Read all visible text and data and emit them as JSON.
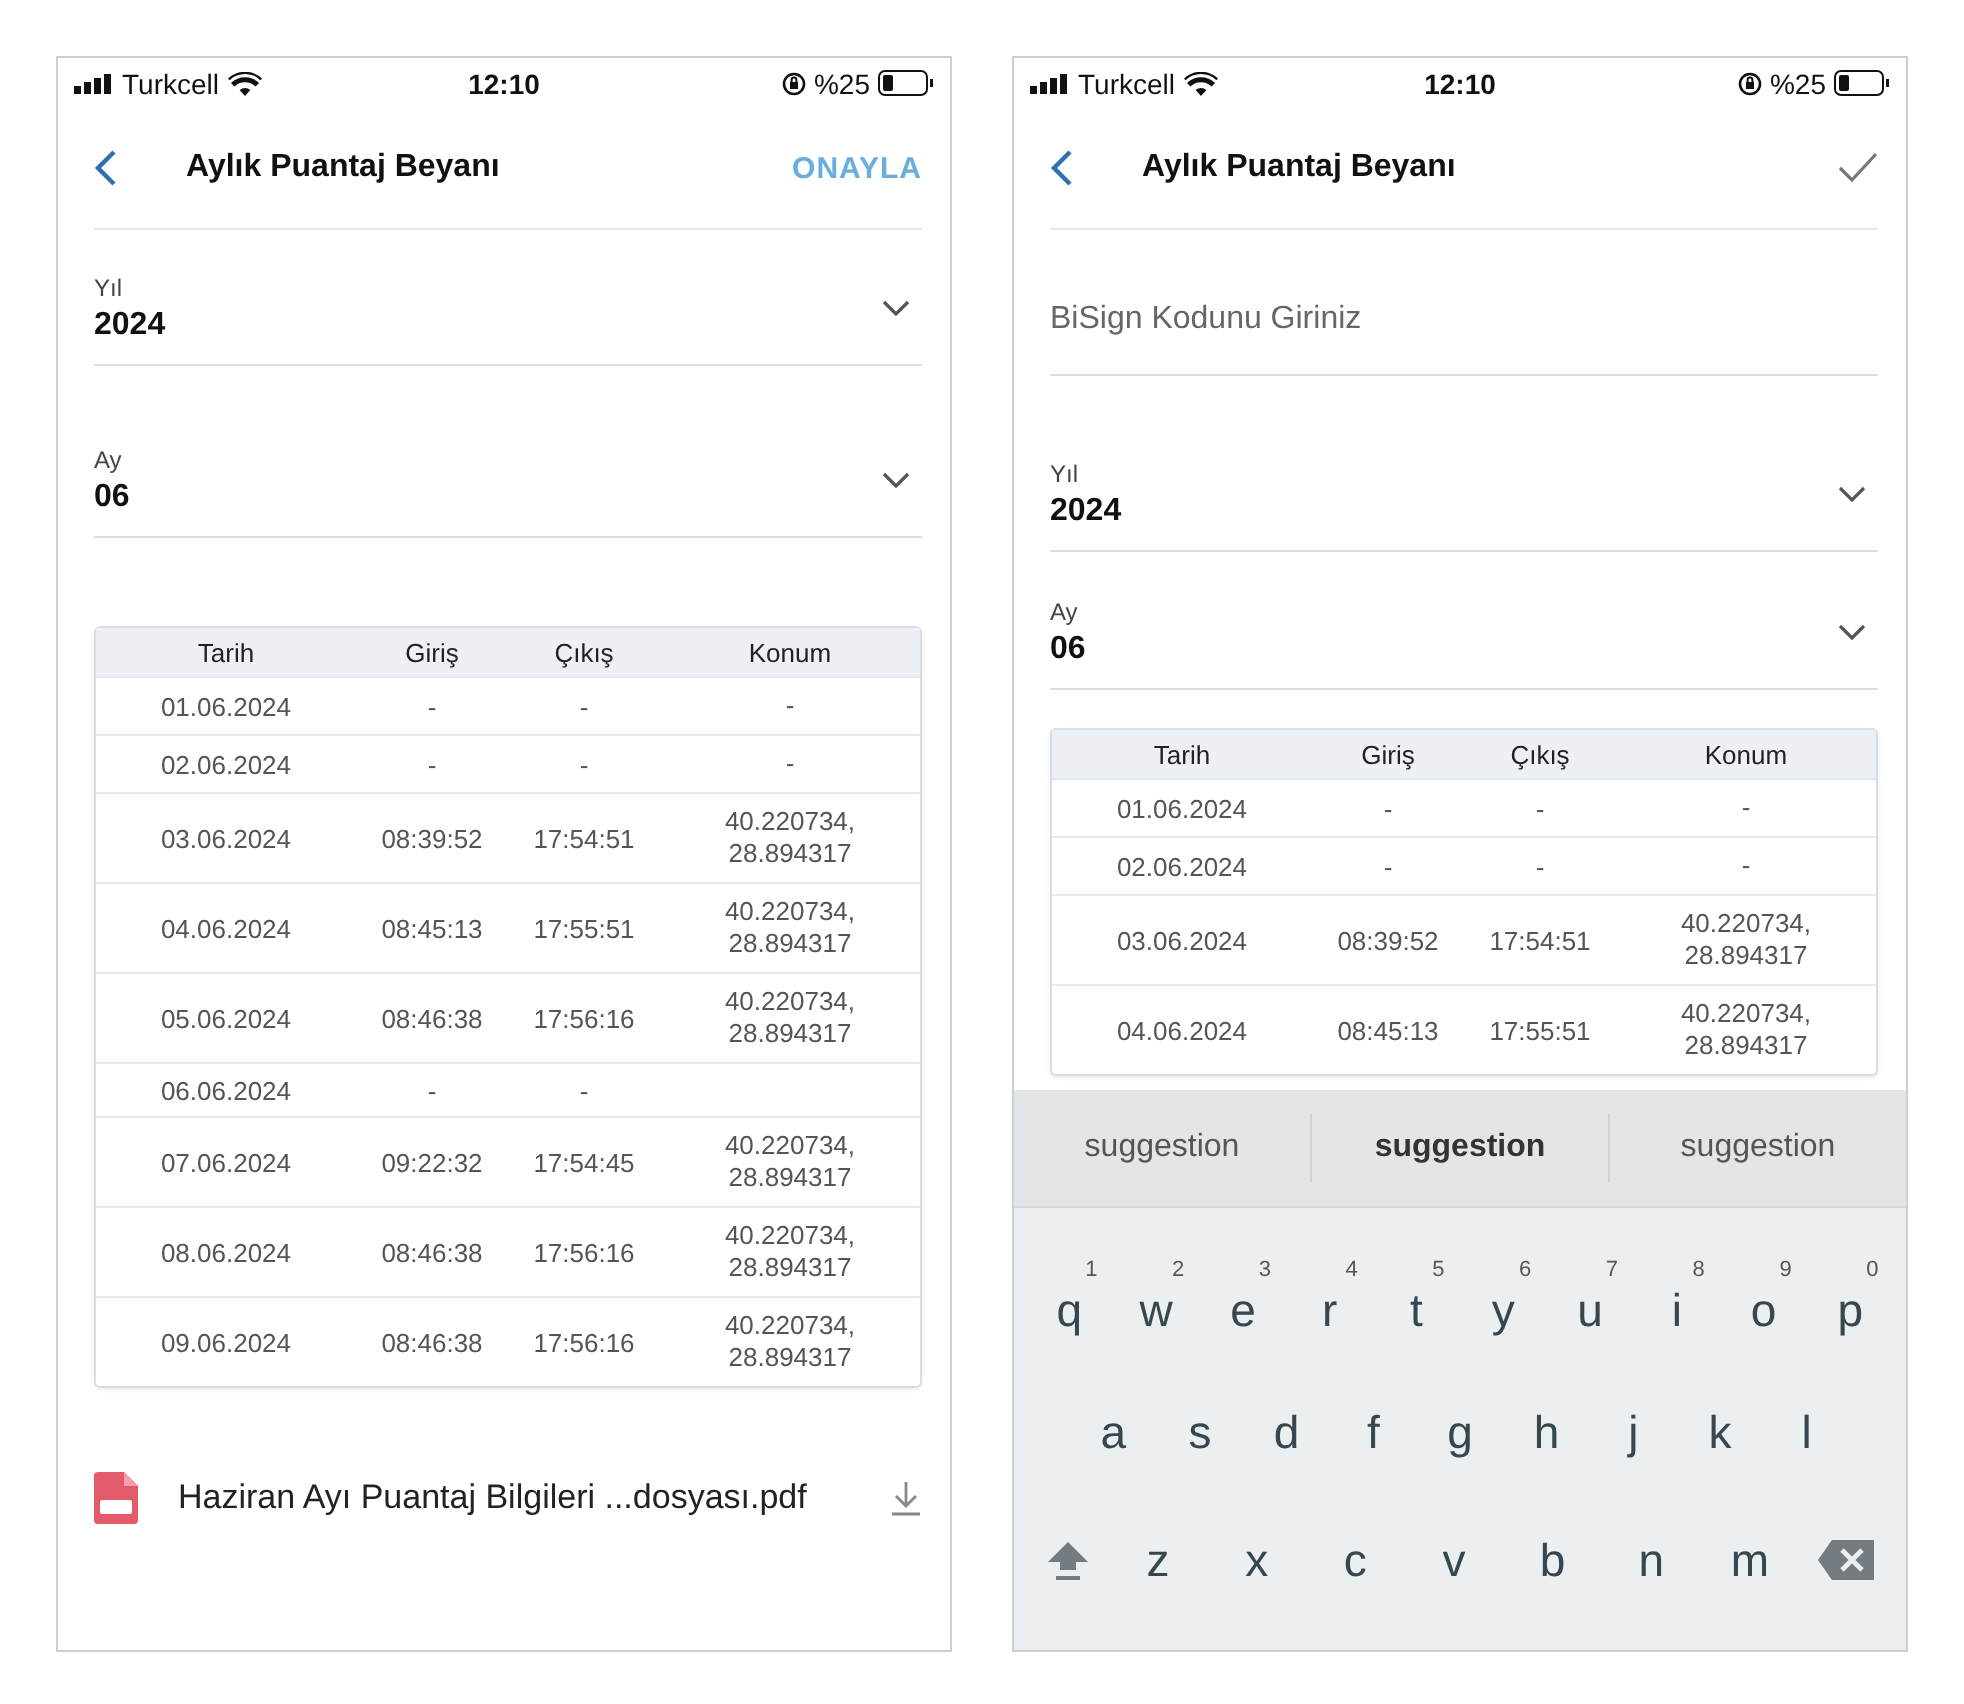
{
  "screens": [
    {
      "status_bar": {
        "carrier": "Turkcell",
        "time": "12:10",
        "battery": "%25"
      },
      "header": {
        "title": "Aylık Puantaj Beyanı",
        "action": {
          "kind": "text",
          "label": "ONAYLA"
        }
      },
      "selects": [
        {
          "label": "Yıl",
          "value": "2024"
        },
        {
          "label": "Ay",
          "value": "06"
        }
      ],
      "table": {
        "columns": [
          "Tarih",
          "Giriş",
          "Çıkış",
          "Konum"
        ],
        "rows": [
          {
            "date": "01.06.2024",
            "in": "-",
            "out": "-",
            "location": "-"
          },
          {
            "date": "02.06.2024",
            "in": "-",
            "out": "-",
            "location": "-"
          },
          {
            "date": "03.06.2024",
            "in": "08:39:52",
            "out": "17:54:51",
            "location": "40.220734, 28.894317"
          },
          {
            "date": "04.06.2024",
            "in": "08:45:13",
            "out": "17:55:51",
            "location": "40.220734, 28.894317"
          },
          {
            "date": "05.06.2024",
            "in": "08:46:38",
            "out": "17:56:16",
            "location": "40.220734, 28.894317"
          },
          {
            "date": "06.06.2024",
            "in": "-",
            "out": "-"
          },
          {
            "date": "07.06.2024",
            "in": "09:22:32",
            "out": "17:54:45",
            "location": "40.220734, 28.894317"
          },
          {
            "date": "08.06.2024",
            "in": "08:46:38",
            "out": "17:56:16",
            "location": "40.220734, 28.894317"
          },
          {
            "date": "09.06.2024",
            "in": "08:46:38",
            "out": "17:56:16",
            "location": "40.220734, 28.894317"
          }
        ]
      },
      "attachment": {
        "name": "Haziran Ayı Puantaj Bilgileri ...dosyası.pdf"
      }
    },
    {
      "status_bar": {
        "carrier": "Turkcell",
        "time": "12:10",
        "battery": "%25"
      },
      "header": {
        "title": "Aylık Puantaj Beyanı",
        "action": {
          "kind": "check"
        }
      },
      "code_field": {
        "placeholder": "BiSign Kodunu Giriniz"
      },
      "selects": [
        {
          "label": "Yıl",
          "value": "2024"
        },
        {
          "label": "Ay",
          "value": "06"
        }
      ],
      "table": {
        "columns": [
          "Tarih",
          "Giriş",
          "Çıkış",
          "Konum"
        ],
        "rows": [
          {
            "date": "01.06.2024",
            "in": "-",
            "out": "-",
            "location": "-"
          },
          {
            "date": "02.06.2024",
            "in": "-",
            "out": "-",
            "location": "-"
          },
          {
            "date": "03.06.2024",
            "in": "08:39:52",
            "out": "17:54:51",
            "location": "40.220734, 28.894317"
          },
          {
            "date": "04.06.2024",
            "in": "08:45:13",
            "out": "17:55:51",
            "location": "40.220734, 28.894317"
          }
        ]
      },
      "keyboard": {
        "suggestions": [
          {
            "text": "suggestion",
            "selected": false
          },
          {
            "text": "suggestion",
            "selected": true
          },
          {
            "text": "suggestion",
            "selected": false
          }
        ],
        "rows": [
          [
            {
              "key": "q",
              "hint": "1"
            },
            {
              "key": "w",
              "hint": "2"
            },
            {
              "key": "e",
              "hint": "3"
            },
            {
              "key": "r",
              "hint": "4"
            },
            {
              "key": "t",
              "hint": "5"
            },
            {
              "key": "y",
              "hint": "6"
            },
            {
              "key": "u",
              "hint": "7"
            },
            {
              "key": "i",
              "hint": "8"
            },
            {
              "key": "o",
              "hint": "9"
            },
            {
              "key": "p",
              "hint": "0"
            }
          ],
          [
            {
              "key": "a"
            },
            {
              "key": "s"
            },
            {
              "key": "d"
            },
            {
              "key": "f"
            },
            {
              "key": "g"
            },
            {
              "key": "h"
            },
            {
              "key": "j"
            },
            {
              "key": "k"
            },
            {
              "key": "l"
            }
          ],
          [
            {
              "key": "z"
            },
            {
              "key": "x"
            },
            {
              "key": "c"
            },
            {
              "key": "v"
            },
            {
              "key": "b"
            },
            {
              "key": "n"
            },
            {
              "key": "m"
            }
          ]
        ]
      }
    }
  ]
}
